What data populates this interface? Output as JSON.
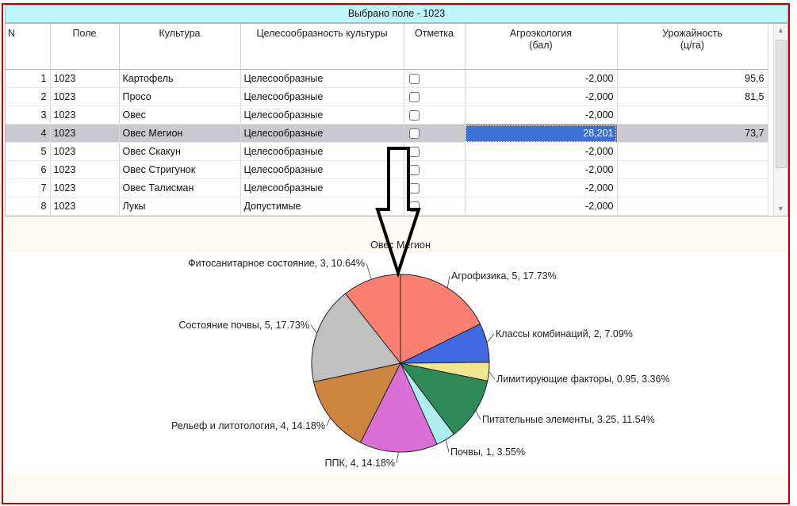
{
  "caption": "Выбрано поле - 1023",
  "columns": {
    "n": "N",
    "field": "Поле",
    "crop": "Культура",
    "suitability": "Целесообразность культуры",
    "mark": "Отметка",
    "agro_1": "Агроэкология",
    "agro_2": "(бал)",
    "yield_1": "Урожайность",
    "yield_2": "(ц/га)"
  },
  "rows": [
    {
      "n": "1",
      "field": "1023",
      "crop": "Картофель",
      "suitability": "Целесообразные",
      "agro": "-2,000",
      "yield": "95,6"
    },
    {
      "n": "2",
      "field": "1023",
      "crop": "Просо",
      "suitability": "Целесообразные",
      "agro": "-2,000",
      "yield": "81,5"
    },
    {
      "n": "3",
      "field": "1023",
      "crop": "Овес",
      "suitability": "Целесообразные",
      "agro": "-2,000",
      "yield": ""
    },
    {
      "n": "4",
      "field": "1023",
      "crop": "Овес Мегион",
      "suitability": "Целесообразные",
      "agro": "28,201",
      "yield": "73,7"
    },
    {
      "n": "5",
      "field": "1023",
      "crop": "Овес Скакун",
      "suitability": "Целесообразные",
      "agro": "-2,000",
      "yield": ""
    },
    {
      "n": "6",
      "field": "1023",
      "crop": "Овес Стригунок",
      "suitability": "Целесообразные",
      "agro": "-2,000",
      "yield": ""
    },
    {
      "n": "7",
      "field": "1023",
      "crop": "Овес Талисман",
      "suitability": "Целесообразные",
      "agro": "-2,000",
      "yield": ""
    },
    {
      "n": "8",
      "field": "1023",
      "crop": "Лукы",
      "suitability": "Допустимые",
      "agro": "-2,000",
      "yield": ""
    }
  ],
  "chart_data": {
    "type": "pie",
    "title": "Овес Мегион",
    "slices": [
      {
        "name": "Агрофизика",
        "value": 5,
        "percent": 17.73,
        "color": "#fa8072",
        "label": "Агрофизика, 5, 17.73%"
      },
      {
        "name": "Классы комбинаций",
        "value": 2,
        "percent": 7.09,
        "color": "#4169e1",
        "label": "Классы комбинаций, 2, 7.09%"
      },
      {
        "name": "Лимитирующие факторы",
        "value": 0.95,
        "percent": 3.36,
        "color": "#f0e68c",
        "label": "Лимитирующие факторы, 0.95, 3.36%"
      },
      {
        "name": "Питательные элементы",
        "value": 3.25,
        "percent": 11.54,
        "color": "#2e8b57",
        "label": "Питательные элементы, 3.25, 11.54%"
      },
      {
        "name": "Почвы",
        "value": 1,
        "percent": 3.55,
        "color": "#afeeee",
        "label": "Почвы, 1, 3.55%"
      },
      {
        "name": "ППК",
        "value": 4,
        "percent": 14.18,
        "color": "#da70d6",
        "label": "ППК, 4, 14.18%"
      },
      {
        "name": "Рельеф и литотология",
        "value": 4,
        "percent": 14.18,
        "color": "#cd853f",
        "label": "Рельеф и литотология, 4, 14.18%"
      },
      {
        "name": "Состояние почвы",
        "value": 5,
        "percent": 17.73,
        "color": "#c0c0c0",
        "label": "Состояние почвы, 5, 17.73%"
      },
      {
        "name": "Фитосанитарное состояние",
        "value": 3,
        "percent": 10.64,
        "color": "#fa8072",
        "label": "Фитосанитарное состояние, 3, 10.64%"
      }
    ]
  },
  "icons": {
    "scroll_up": "scroll-up-arrow-icon",
    "scroll_down": "scroll-down-arrow-icon",
    "annotation": "down-arrow-icon"
  }
}
